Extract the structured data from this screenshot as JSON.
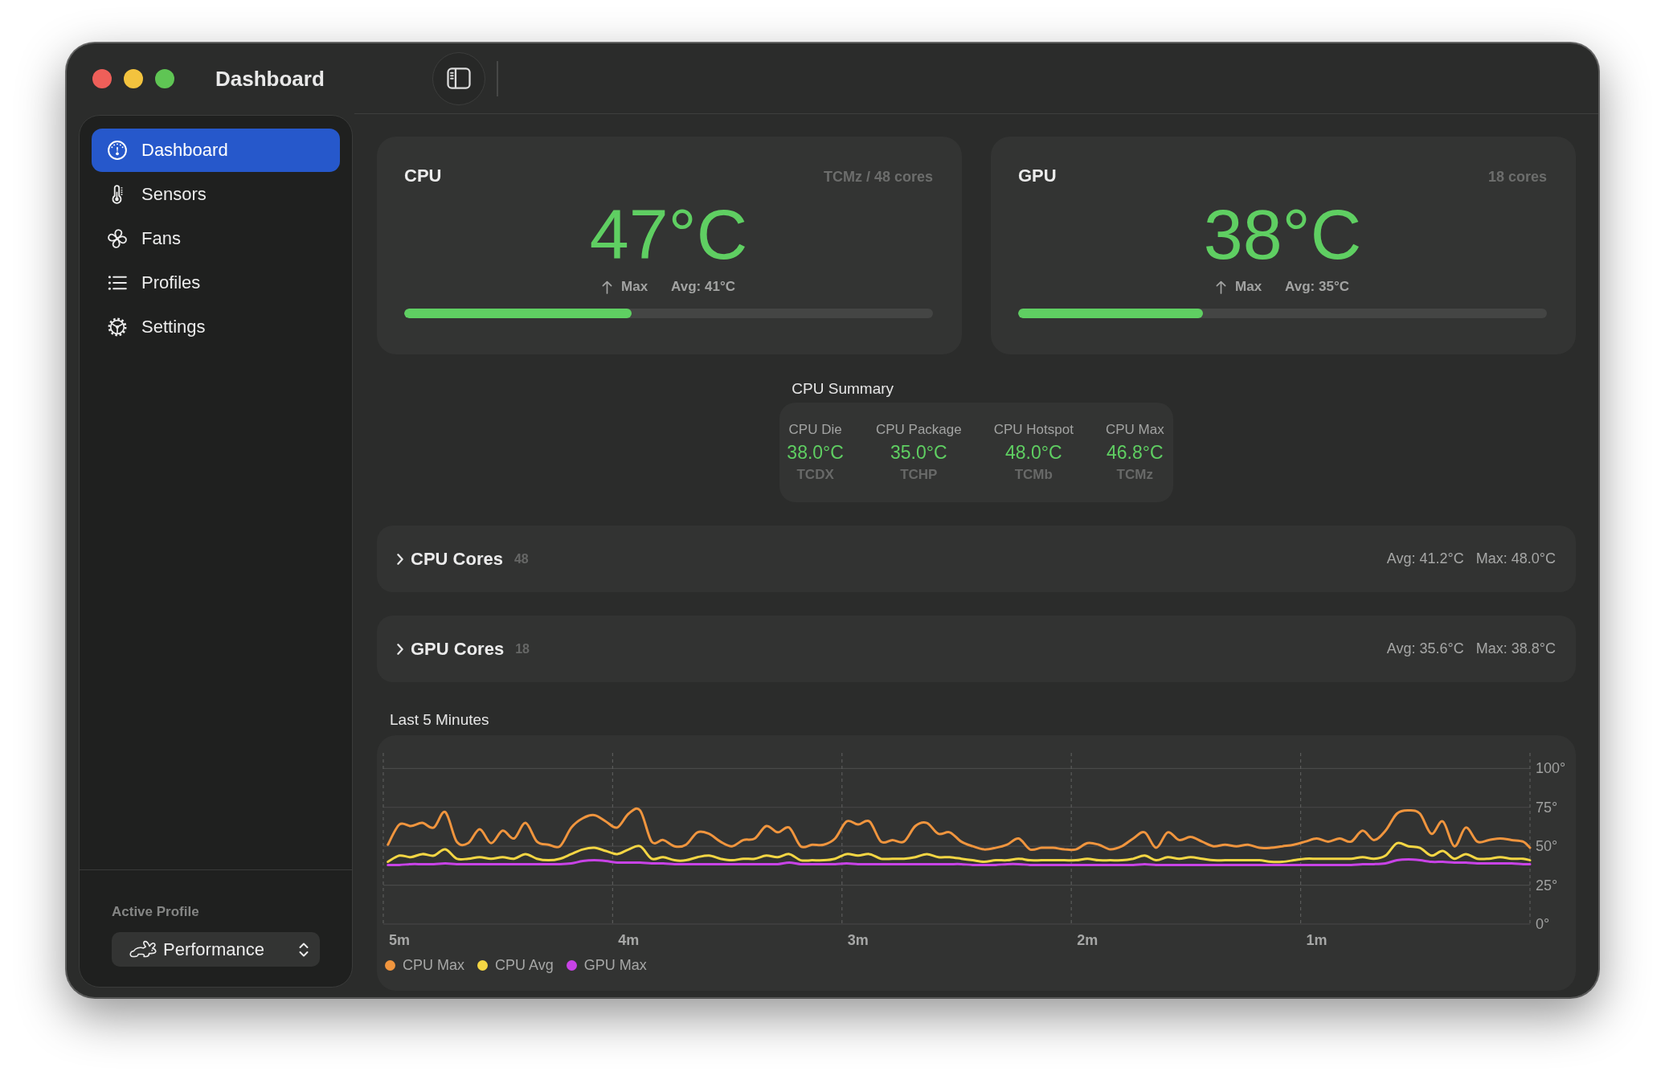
{
  "window": {
    "title": "Dashboard"
  },
  "sidebar": {
    "items": [
      {
        "label": "Dashboard",
        "selected": true
      },
      {
        "label": "Sensors",
        "selected": false
      },
      {
        "label": "Fans",
        "selected": false
      },
      {
        "label": "Profiles",
        "selected": false
      },
      {
        "label": "Settings",
        "selected": false
      }
    ],
    "active_profile": {
      "label": "Active Profile",
      "value": "Performance"
    }
  },
  "gauges": [
    {
      "title": "CPU",
      "source": "TCMz / 48 cores",
      "temperature": "47°C",
      "max_label": "Max",
      "average": "Avg: 41°C",
      "level": 0.43
    },
    {
      "title": "GPU",
      "source": "18 cores",
      "temperature": "38°C",
      "max_label": "Max",
      "average": "Avg: 35°C",
      "level": 0.35
    }
  ],
  "cpu_summary": {
    "title": "CPU Summary",
    "sensors": [
      {
        "label": "CPU Die",
        "value": "38.0°C",
        "key": "TCDX"
      },
      {
        "label": "CPU Package",
        "value": "35.0°C",
        "key": "TCHP"
      },
      {
        "label": "CPU Hotspot",
        "value": "48.0°C",
        "key": "TCMb"
      },
      {
        "label": "CPU Max",
        "value": "46.8°C",
        "key": "TCMz"
      }
    ]
  },
  "core_groups": [
    {
      "title": "CPU Cores",
      "count": "48",
      "expanded": false,
      "average": "Avg: 41.2°C",
      "maximum": "Max: 48.0°C"
    },
    {
      "title": "GPU Cores",
      "count": "18",
      "expanded": false,
      "average": "Avg: 35.6°C",
      "maximum": "Max: 38.8°C"
    }
  ],
  "history": {
    "chart_data": {
      "type": "line",
      "title": "Last 5 Minutes",
      "x": [
        5.05,
        5,
        4.95,
        4.9,
        4.85,
        4.8,
        4.75,
        4.7,
        4.65,
        4.6,
        4.55,
        4.5,
        4.45,
        4.4,
        4.35,
        4.3,
        4.25,
        4.2,
        4.15,
        4.1,
        4.05,
        4,
        3.95,
        3.9,
        3.85,
        3.8,
        3.75,
        3.7,
        3.65,
        3.6,
        3.55,
        3.5,
        3.45,
        3.4,
        3.35,
        3.3,
        3.25,
        3.2,
        3.15,
        3.1,
        3.05,
        3,
        2.95,
        2.9,
        2.85,
        2.8,
        2.75,
        2.7,
        2.65,
        2.6,
        2.55,
        2.5,
        2.45,
        2.4,
        2.35,
        2.3,
        2.25,
        2.2,
        2.15,
        2.1,
        2.05,
        2,
        1.95,
        1.9,
        1.85,
        1.8,
        1.75,
        1.7,
        1.65,
        1.6,
        1.55,
        1.5,
        1.45,
        1.4,
        1.35,
        1.3,
        1.25,
        1.2,
        1.15,
        1.1,
        1.05,
        1,
        0.95,
        0.9,
        0.85,
        0.8,
        0.75,
        0.7,
        0.65,
        0.6,
        0.55,
        0.5,
        0.45,
        0.4,
        0.35,
        0.3,
        0.25,
        0.2,
        0.15,
        0.1,
        0.07
      ],
      "series": [
        {
          "name": "CPU Max",
          "color": "#f0953e",
          "values": [
            51,
            64,
            63,
            65,
            62,
            72,
            53,
            52,
            61,
            52,
            60,
            55,
            65,
            53,
            51,
            50,
            62,
            68,
            70,
            66,
            62,
            71,
            73,
            53,
            54,
            50,
            51,
            59,
            58,
            53,
            50,
            54,
            55,
            63,
            59,
            62,
            50,
            51,
            51,
            55,
            66,
            64,
            66,
            53,
            54,
            53,
            63,
            65,
            58,
            59,
            53,
            50,
            48,
            49,
            51,
            55,
            48,
            49,
            49,
            48,
            48,
            52,
            51,
            48,
            50,
            55,
            59,
            49,
            59,
            54,
            56,
            53,
            50,
            51,
            50,
            51,
            49,
            49,
            50,
            51,
            53,
            55,
            53,
            55,
            53,
            60,
            54,
            60,
            71,
            73,
            71,
            58,
            66,
            50,
            62,
            53,
            54,
            55,
            54,
            53,
            49
          ]
        },
        {
          "name": "CPU Avg",
          "color": "#f4d644",
          "values": [
            40,
            44,
            43,
            45,
            44,
            48,
            42,
            42,
            43,
            42,
            43,
            42,
            45,
            42,
            41,
            42,
            45,
            48,
            49,
            47,
            45,
            48,
            50,
            42,
            43,
            41,
            41,
            43,
            44,
            42,
            41,
            42,
            42,
            44,
            43,
            45,
            41,
            41,
            41,
            42,
            45,
            44,
            45,
            42,
            42,
            42,
            43,
            45,
            43,
            43,
            42,
            41,
            40,
            41,
            41,
            42,
            41,
            41,
            41,
            41,
            41,
            42,
            41,
            41,
            41,
            42,
            44,
            41,
            43,
            42,
            43,
            42,
            41,
            41,
            41,
            41,
            41,
            40,
            40,
            41,
            42,
            42,
            42,
            42,
            42,
            43,
            42,
            44,
            52,
            50,
            49,
            44,
            47,
            42,
            45,
            42,
            42,
            43,
            42,
            42,
            41
          ]
        },
        {
          "name": "GPU Max",
          "color": "#c843e6",
          "values": [
            38,
            38,
            38.5,
            38.5,
            38.5,
            39,
            38.5,
            38.5,
            38.5,
            38.5,
            38.5,
            38.5,
            38.5,
            38.5,
            38.5,
            38.5,
            39,
            40.5,
            41,
            40.5,
            39.5,
            39.5,
            39.5,
            39,
            39,
            38.5,
            38.5,
            38.5,
            38.5,
            38.5,
            38.5,
            38.5,
            38.5,
            38.5,
            38.5,
            39.5,
            38.5,
            38.5,
            38.5,
            38.5,
            39,
            38.5,
            38.5,
            38.5,
            38.5,
            38.5,
            38.5,
            38.5,
            38.5,
            38.5,
            38.5,
            38,
            38,
            38,
            38.5,
            38.5,
            38,
            38,
            38,
            38,
            38,
            38,
            38,
            38,
            38,
            38,
            38.5,
            38,
            38,
            38,
            38,
            38,
            38,
            38,
            38,
            38,
            38,
            38,
            38,
            38,
            38,
            38,
            38,
            38,
            38,
            38.5,
            38.5,
            39,
            41,
            41.5,
            41,
            40,
            40,
            39.5,
            39.5,
            39,
            39,
            39,
            39,
            38.5,
            38.5
          ]
        }
      ],
      "xlim": [
        5.07,
        0.07
      ],
      "ylim": [
        0,
        110
      ],
      "xticks": [
        {
          "value": 5,
          "label": "5m"
        },
        {
          "value": 4,
          "label": "4m"
        },
        {
          "value": 3,
          "label": "3m"
        },
        {
          "value": 2,
          "label": "2m"
        },
        {
          "value": 1,
          "label": "1m"
        }
      ],
      "yticks": [
        {
          "value": 0,
          "label": "0°"
        },
        {
          "value": 25,
          "label": "25°"
        },
        {
          "value": 50,
          "label": "50°"
        },
        {
          "value": 75,
          "label": "75°"
        },
        {
          "value": 100,
          "label": "100°"
        }
      ],
      "grid": true,
      "legend": "bottom"
    }
  }
}
